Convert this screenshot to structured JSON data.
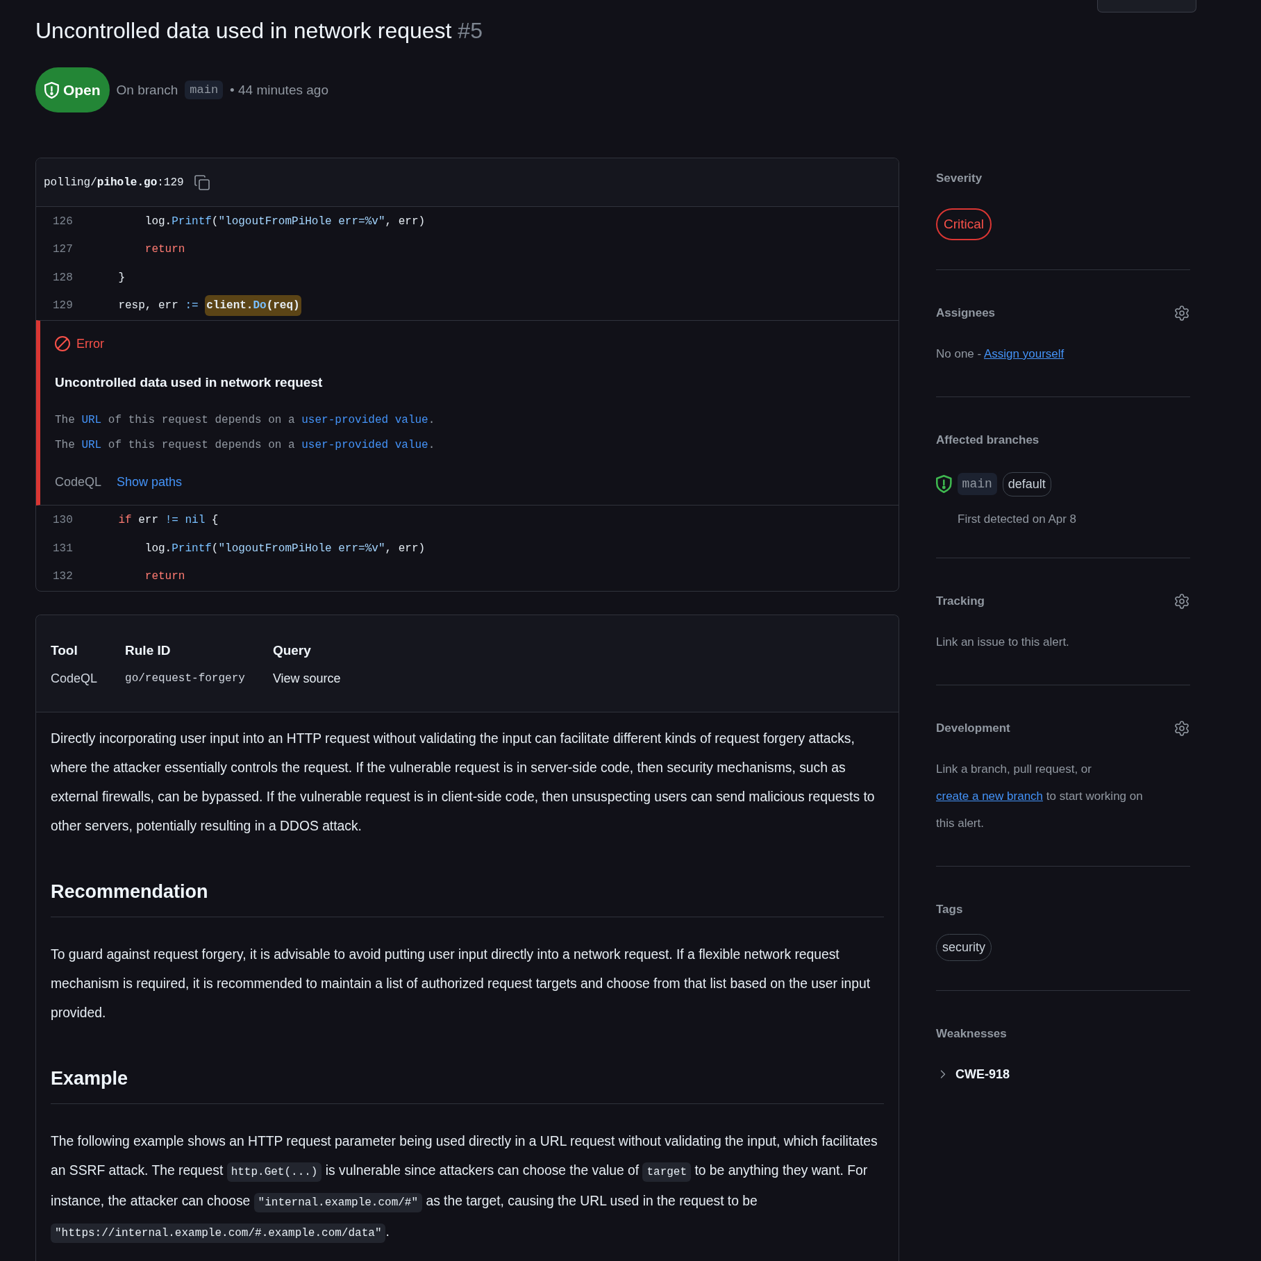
{
  "header": {
    "title": "Uncontrolled data used in network request",
    "number": "#5"
  },
  "status": {
    "kind": "open",
    "label": "Open",
    "branch_prefix": "On branch",
    "branch": "main",
    "age": "• 44 minutes ago"
  },
  "code_card": {
    "file": "polling/**pihole.go**:129",
    "lines_before": [
      {
        "number": "126",
        "segments": [
          {
            "marked": false,
            "tokens": [
              {
                "kind": "plain",
                "text": "\t\tlog."
              },
              {
                "kind": "func",
                "text": "Printf"
              },
              {
                "kind": "plain",
                "text": "("
              },
              {
                "kind": "string",
                "text": "\"logoutFromPiHole err=%v\""
              },
              {
                "kind": "plain",
                "text": ", err)"
              }
            ]
          }
        ]
      },
      {
        "number": "127",
        "segments": [
          {
            "marked": false,
            "tokens": [
              {
                "kind": "keyword",
                "text": "\t\treturn"
              }
            ]
          }
        ]
      },
      {
        "number": "128",
        "segments": [
          {
            "marked": false,
            "tokens": [
              {
                "kind": "plain",
                "text": "\t}"
              }
            ]
          }
        ]
      },
      {
        "number": "129",
        "segments": [
          {
            "marked": false,
            "tokens": [
              {
                "kind": "plain",
                "text": "\tresp, err "
              },
              {
                "kind": "operator",
                "text": ":="
              }
            ]
          },
          {
            "marked": true,
            "tokens": [
              {
                "kind": "plain",
                "text": "client."
              },
              {
                "kind": "func",
                "text": "Do"
              },
              {
                "kind": "plain",
                "text": "(req)"
              }
            ]
          }
        ]
      }
    ],
    "alert": {
      "label": "Error",
      "title": "Uncontrolled data used in network request",
      "messages": [
        {
          "parts": [
            {
              "kind": "text",
              "text": "The "
            },
            {
              "kind": "link",
              "text": "URL"
            },
            {
              "kind": "text",
              "text": " of this request depends on a "
            },
            {
              "kind": "link",
              "text": "user-provided value"
            },
            {
              "kind": "text",
              "text": "."
            }
          ]
        },
        {
          "parts": [
            {
              "kind": "text",
              "text": "The "
            },
            {
              "kind": "link",
              "text": "URL"
            },
            {
              "kind": "text",
              "text": " of this request depends on a "
            },
            {
              "kind": "link",
              "text": "user-provided value"
            },
            {
              "kind": "text",
              "text": "."
            }
          ]
        }
      ],
      "tool": "CodeQL",
      "action": "Show paths"
    },
    "lines_after": [
      {
        "number": "130",
        "segments": [
          {
            "marked": false,
            "tokens": [
              {
                "kind": "keyword",
                "text": "\tif"
              },
              {
                "kind": "plain",
                "text": " err "
              },
              {
                "kind": "operator",
                "text": "!="
              },
              {
                "kind": "constant",
                "text": " nil"
              },
              {
                "kind": "plain",
                "text": " {"
              }
            ]
          }
        ]
      },
      {
        "number": "131",
        "segments": [
          {
            "marked": false,
            "tokens": [
              {
                "kind": "plain",
                "text": "\t\tlog."
              },
              {
                "kind": "func",
                "text": "Printf"
              },
              {
                "kind": "plain",
                "text": "("
              },
              {
                "kind": "string",
                "text": "\"logoutFromPiHole err=%v\""
              },
              {
                "kind": "plain",
                "text": ", err)"
              }
            ]
          }
        ]
      },
      {
        "number": "132",
        "segments": [
          {
            "marked": false,
            "tokens": [
              {
                "kind": "keyword",
                "text": "\t\treturn"
              }
            ]
          }
        ]
      }
    ]
  },
  "details": {
    "columns": [
      {
        "label": "Tool",
        "value": "CodeQL",
        "kind": "text"
      },
      {
        "label": "Rule ID",
        "value": "go/request-forgery",
        "kind": "code"
      },
      {
        "label": "Query",
        "value": "View source",
        "kind": "link"
      }
    ],
    "body": [
      {
        "kind": "paragraph",
        "parts": [
          {
            "kind": "text",
            "text": "Directly incorporating user input into an HTTP request without validating the input can facilitate different kinds of request forgery attacks, where the attacker essentially controls the request. If the vulnerable request is in server-side code, then security mechanisms, such as external firewalls, can be bypassed. If the vulnerable request is in client-side code, then unsuspecting users can send malicious requests to other servers, potentially resulting in a DDOS attack."
          }
        ]
      },
      {
        "kind": "heading",
        "text": "Recommendation"
      },
      {
        "kind": "paragraph",
        "parts": [
          {
            "kind": "text",
            "text": "To guard against request forgery, it is advisable to avoid putting user input directly into a network request. If a flexible network request mechanism is required, it is recommended to maintain a list of authorized request targets and choose from that list based on the user input provided."
          }
        ]
      },
      {
        "kind": "heading",
        "text": "Example"
      },
      {
        "kind": "paragraph",
        "parts": [
          {
            "kind": "text",
            "text": "The following example shows an HTTP request parameter being used directly in a URL request without validating the input, which facilitates an SSRF attack. The request "
          },
          {
            "kind": "code",
            "text": "http.Get(...)"
          },
          {
            "kind": "text",
            "text": " is vulnerable since attackers can choose the value of "
          },
          {
            "kind": "code",
            "text": "target"
          },
          {
            "kind": "text",
            "text": " to be anything they want. For instance, the attacker can choose "
          },
          {
            "kind": "code",
            "text": "\"internal.example.com/#\""
          },
          {
            "kind": "text",
            "text": " as the target, causing the URL used in the request to be "
          },
          {
            "kind": "code",
            "text": "\"https://internal.example.com/#.example.com/data\""
          },
          {
            "kind": "text",
            "text": "."
          }
        ]
      }
    ]
  },
  "sidebar": {
    "sections": [
      {
        "kind": "severity",
        "title": "Severity",
        "settings": false,
        "label": "Critical"
      },
      {
        "kind": "text",
        "title": "Assignees",
        "settings": true,
        "parts": [
          {
            "kind": "text",
            "text": "No one - "
          },
          {
            "kind": "link",
            "text": "Assign yourself"
          }
        ]
      },
      {
        "kind": "branches",
        "title": "Affected branches",
        "settings": false,
        "branches": [
          {
            "name": "main",
            "badge": "default",
            "detected": "First detected on Apr 8"
          }
        ]
      },
      {
        "kind": "text",
        "title": "Tracking",
        "settings": true,
        "parts": [
          {
            "kind": "text",
            "text": "Link an issue to this alert."
          }
        ]
      },
      {
        "kind": "text",
        "title": "Development",
        "settings": true,
        "parts": [
          {
            "kind": "text",
            "text": "Link a branch, pull request, or "
          },
          {
            "kind": "link",
            "text": "create a new branch"
          },
          {
            "kind": "text",
            "text": " to start working on this alert."
          }
        ]
      },
      {
        "kind": "tags",
        "title": "Tags",
        "settings": false,
        "tags": [
          "security"
        ]
      },
      {
        "kind": "weaknesses",
        "title": "Weaknesses",
        "settings": false,
        "items": [
          {
            "label": "CWE-918",
            "expanded": false
          }
        ]
      }
    ]
  }
}
